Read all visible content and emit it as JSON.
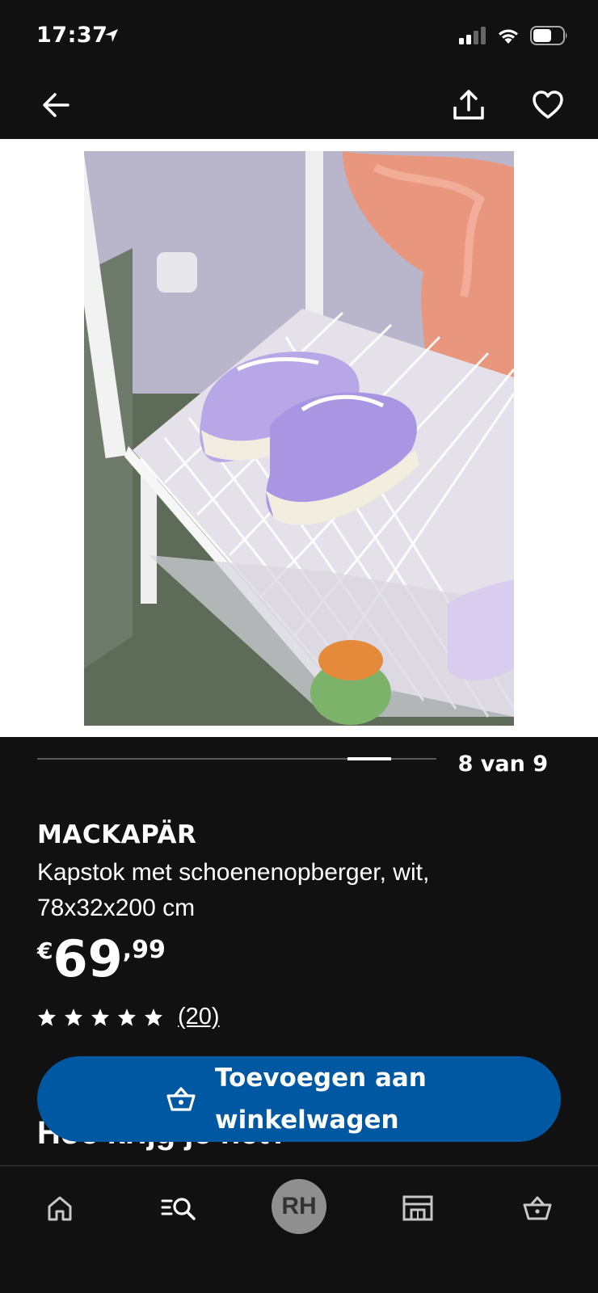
{
  "status_bar": {
    "time": "17:37"
  },
  "gallery": {
    "current": 8,
    "total": 9,
    "counter_text": "8 van 9",
    "photo_subject": "white metal mesh shoe rack with purple children's sneakers"
  },
  "product": {
    "name": "MACKAPÄR",
    "description": "Kapstok met schoenenopberger, wit, 78x32x200 cm",
    "price": {
      "currency": "€",
      "integer": "69",
      "decimal": ",99"
    },
    "rating": {
      "stars": 5,
      "review_count": "(20)"
    }
  },
  "actions": {
    "add_to_cart_label": "Toevoegen aan winkelwagen"
  },
  "sections": {
    "delivery_title": "Hoe krijg je het?"
  },
  "tab_bar": {
    "items": [
      "home-icon",
      "search-icon",
      "profile-avatar",
      "store-icon",
      "cart-icon"
    ],
    "avatar_initials": "RH"
  },
  "colors": {
    "background": "#111111",
    "primary_button": "#0058a3",
    "text": "#ffffff",
    "pager_track": "#5a5a5a",
    "avatar_bg": "#8f8f8f"
  }
}
